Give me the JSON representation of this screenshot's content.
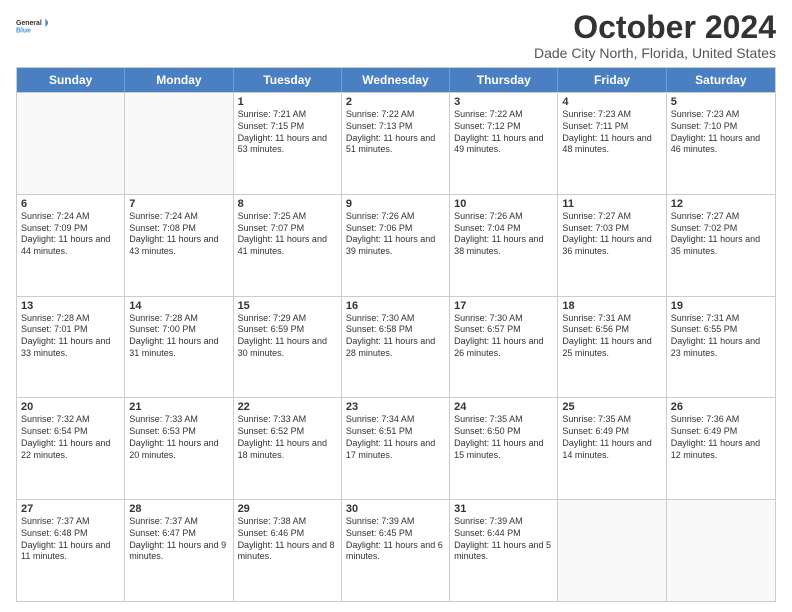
{
  "logo": {
    "general": "General",
    "blue": "Blue"
  },
  "title": "October 2024",
  "subtitle": "Dade City North, Florida, United States",
  "days_of_week": [
    "Sunday",
    "Monday",
    "Tuesday",
    "Wednesday",
    "Thursday",
    "Friday",
    "Saturday"
  ],
  "weeks": [
    [
      {
        "day": "",
        "sunrise": "",
        "sunset": "",
        "daylight": "",
        "empty": true
      },
      {
        "day": "",
        "sunrise": "",
        "sunset": "",
        "daylight": "",
        "empty": true
      },
      {
        "day": "1",
        "sunrise": "Sunrise: 7:21 AM",
        "sunset": "Sunset: 7:15 PM",
        "daylight": "Daylight: 11 hours and 53 minutes."
      },
      {
        "day": "2",
        "sunrise": "Sunrise: 7:22 AM",
        "sunset": "Sunset: 7:13 PM",
        "daylight": "Daylight: 11 hours and 51 minutes."
      },
      {
        "day": "3",
        "sunrise": "Sunrise: 7:22 AM",
        "sunset": "Sunset: 7:12 PM",
        "daylight": "Daylight: 11 hours and 49 minutes."
      },
      {
        "day": "4",
        "sunrise": "Sunrise: 7:23 AM",
        "sunset": "Sunset: 7:11 PM",
        "daylight": "Daylight: 11 hours and 48 minutes."
      },
      {
        "day": "5",
        "sunrise": "Sunrise: 7:23 AM",
        "sunset": "Sunset: 7:10 PM",
        "daylight": "Daylight: 11 hours and 46 minutes."
      }
    ],
    [
      {
        "day": "6",
        "sunrise": "Sunrise: 7:24 AM",
        "sunset": "Sunset: 7:09 PM",
        "daylight": "Daylight: 11 hours and 44 minutes."
      },
      {
        "day": "7",
        "sunrise": "Sunrise: 7:24 AM",
        "sunset": "Sunset: 7:08 PM",
        "daylight": "Daylight: 11 hours and 43 minutes."
      },
      {
        "day": "8",
        "sunrise": "Sunrise: 7:25 AM",
        "sunset": "Sunset: 7:07 PM",
        "daylight": "Daylight: 11 hours and 41 minutes."
      },
      {
        "day": "9",
        "sunrise": "Sunrise: 7:26 AM",
        "sunset": "Sunset: 7:06 PM",
        "daylight": "Daylight: 11 hours and 39 minutes."
      },
      {
        "day": "10",
        "sunrise": "Sunrise: 7:26 AM",
        "sunset": "Sunset: 7:04 PM",
        "daylight": "Daylight: 11 hours and 38 minutes."
      },
      {
        "day": "11",
        "sunrise": "Sunrise: 7:27 AM",
        "sunset": "Sunset: 7:03 PM",
        "daylight": "Daylight: 11 hours and 36 minutes."
      },
      {
        "day": "12",
        "sunrise": "Sunrise: 7:27 AM",
        "sunset": "Sunset: 7:02 PM",
        "daylight": "Daylight: 11 hours and 35 minutes."
      }
    ],
    [
      {
        "day": "13",
        "sunrise": "Sunrise: 7:28 AM",
        "sunset": "Sunset: 7:01 PM",
        "daylight": "Daylight: 11 hours and 33 minutes."
      },
      {
        "day": "14",
        "sunrise": "Sunrise: 7:28 AM",
        "sunset": "Sunset: 7:00 PM",
        "daylight": "Daylight: 11 hours and 31 minutes."
      },
      {
        "day": "15",
        "sunrise": "Sunrise: 7:29 AM",
        "sunset": "Sunset: 6:59 PM",
        "daylight": "Daylight: 11 hours and 30 minutes."
      },
      {
        "day": "16",
        "sunrise": "Sunrise: 7:30 AM",
        "sunset": "Sunset: 6:58 PM",
        "daylight": "Daylight: 11 hours and 28 minutes."
      },
      {
        "day": "17",
        "sunrise": "Sunrise: 7:30 AM",
        "sunset": "Sunset: 6:57 PM",
        "daylight": "Daylight: 11 hours and 26 minutes."
      },
      {
        "day": "18",
        "sunrise": "Sunrise: 7:31 AM",
        "sunset": "Sunset: 6:56 PM",
        "daylight": "Daylight: 11 hours and 25 minutes."
      },
      {
        "day": "19",
        "sunrise": "Sunrise: 7:31 AM",
        "sunset": "Sunset: 6:55 PM",
        "daylight": "Daylight: 11 hours and 23 minutes."
      }
    ],
    [
      {
        "day": "20",
        "sunrise": "Sunrise: 7:32 AM",
        "sunset": "Sunset: 6:54 PM",
        "daylight": "Daylight: 11 hours and 22 minutes."
      },
      {
        "day": "21",
        "sunrise": "Sunrise: 7:33 AM",
        "sunset": "Sunset: 6:53 PM",
        "daylight": "Daylight: 11 hours and 20 minutes."
      },
      {
        "day": "22",
        "sunrise": "Sunrise: 7:33 AM",
        "sunset": "Sunset: 6:52 PM",
        "daylight": "Daylight: 11 hours and 18 minutes."
      },
      {
        "day": "23",
        "sunrise": "Sunrise: 7:34 AM",
        "sunset": "Sunset: 6:51 PM",
        "daylight": "Daylight: 11 hours and 17 minutes."
      },
      {
        "day": "24",
        "sunrise": "Sunrise: 7:35 AM",
        "sunset": "Sunset: 6:50 PM",
        "daylight": "Daylight: 11 hours and 15 minutes."
      },
      {
        "day": "25",
        "sunrise": "Sunrise: 7:35 AM",
        "sunset": "Sunset: 6:49 PM",
        "daylight": "Daylight: 11 hours and 14 minutes."
      },
      {
        "day": "26",
        "sunrise": "Sunrise: 7:36 AM",
        "sunset": "Sunset: 6:49 PM",
        "daylight": "Daylight: 11 hours and 12 minutes."
      }
    ],
    [
      {
        "day": "27",
        "sunrise": "Sunrise: 7:37 AM",
        "sunset": "Sunset: 6:48 PM",
        "daylight": "Daylight: 11 hours and 11 minutes."
      },
      {
        "day": "28",
        "sunrise": "Sunrise: 7:37 AM",
        "sunset": "Sunset: 6:47 PM",
        "daylight": "Daylight: 11 hours and 9 minutes."
      },
      {
        "day": "29",
        "sunrise": "Sunrise: 7:38 AM",
        "sunset": "Sunset: 6:46 PM",
        "daylight": "Daylight: 11 hours and 8 minutes."
      },
      {
        "day": "30",
        "sunrise": "Sunrise: 7:39 AM",
        "sunset": "Sunset: 6:45 PM",
        "daylight": "Daylight: 11 hours and 6 minutes."
      },
      {
        "day": "31",
        "sunrise": "Sunrise: 7:39 AM",
        "sunset": "Sunset: 6:44 PM",
        "daylight": "Daylight: 11 hours and 5 minutes."
      },
      {
        "day": "",
        "sunrise": "",
        "sunset": "",
        "daylight": "",
        "empty": true
      },
      {
        "day": "",
        "sunrise": "",
        "sunset": "",
        "daylight": "",
        "empty": true
      }
    ]
  ]
}
